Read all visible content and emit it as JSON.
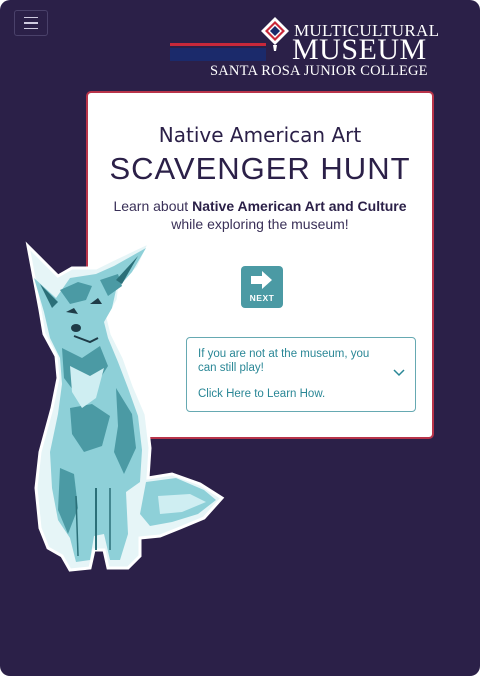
{
  "header": {
    "menu_icon": "hamburger-icon",
    "logo": {
      "line1": "MULTICULTURAL",
      "line2": "MUSEUM",
      "line3": "SANTA ROSA JUNIOR COLLEGE"
    }
  },
  "card": {
    "subtitle": "Native American Art",
    "title": "SCAVENGER HUNT",
    "desc_prefix": "Learn about ",
    "desc_bold": "Native American Art and Culture",
    "desc_suffix": "while exploring the museum!",
    "next_label": "NEXT",
    "remote": {
      "text": "If you are not at the museum, you can still play!",
      "link": "Click Here to Learn How."
    }
  },
  "colors": {
    "background": "#2b2048",
    "accent_teal": "#4b9aa4",
    "card_border": "#b8344a",
    "logo_navy": "#1b2a6b",
    "logo_red": "#c8283a"
  }
}
